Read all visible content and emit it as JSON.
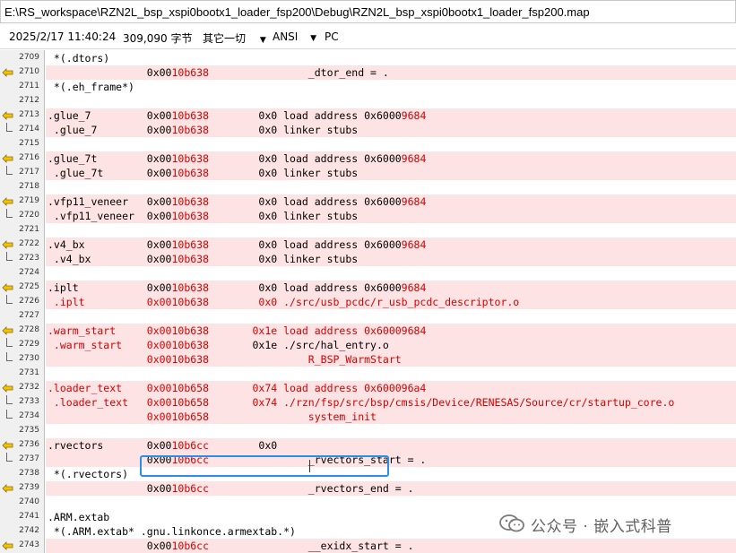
{
  "window": {
    "title": "E:\\RS_workspace\\RZN2L_bsp_xspi0bootx1_loader_fsp200\\Debug\\RZN2L_bsp_xspi0bootx1_loader_fsp200.map"
  },
  "status_bar": {
    "datetime": "2025/2/17 11:40:24",
    "size": "309,090 字节",
    "line_ending": "其它一切",
    "encoding": "ANSI",
    "platform": "PC"
  },
  "colors": {
    "highlight_bg": "#fde3e3",
    "red_text": "#d40000",
    "selection_box": "#2d8ee6"
  },
  "lines": [
    {
      "num": "2709",
      "mark": "",
      "hl": false,
      "segs": [
        {
          "t": " *(.dtors)",
          "c": "k"
        }
      ]
    },
    {
      "num": "2710",
      "mark": "arrow",
      "hl": true,
      "segs": [
        {
          "t": "                0x00",
          "c": "k"
        },
        {
          "t": "10b638",
          "c": "r"
        },
        {
          "t": "                _dtor_end = .",
          "c": "k"
        }
      ]
    },
    {
      "num": "2711",
      "mark": "",
      "hl": false,
      "segs": [
        {
          "t": " *(.eh_frame*)",
          "c": "k"
        }
      ]
    },
    {
      "num": "2712",
      "mark": "",
      "hl": false,
      "segs": []
    },
    {
      "num": "2713",
      "mark": "arrow",
      "hl": true,
      "segs": [
        {
          "t": ".glue_7         0x00",
          "c": "k"
        },
        {
          "t": "10b638",
          "c": "r"
        },
        {
          "t": "        0x0 load address 0x6000",
          "c": "k"
        },
        {
          "t": "9684",
          "c": "r"
        }
      ]
    },
    {
      "num": "2714",
      "mark": "bracket",
      "hl": true,
      "segs": [
        {
          "t": " .glue_7        0x00",
          "c": "k"
        },
        {
          "t": "10b638",
          "c": "r"
        },
        {
          "t": "        0x0 linker stubs",
          "c": "k"
        }
      ]
    },
    {
      "num": "2715",
      "mark": "",
      "hl": false,
      "segs": []
    },
    {
      "num": "2716",
      "mark": "arrow",
      "hl": true,
      "segs": [
        {
          "t": ".glue_7t        0x00",
          "c": "k"
        },
        {
          "t": "10b638",
          "c": "r"
        },
        {
          "t": "        0x0 load address 0x6000",
          "c": "k"
        },
        {
          "t": "9684",
          "c": "r"
        }
      ]
    },
    {
      "num": "2717",
      "mark": "bracket",
      "hl": true,
      "segs": [
        {
          "t": " .glue_7t       0x00",
          "c": "k"
        },
        {
          "t": "10b638",
          "c": "r"
        },
        {
          "t": "        0x0 linker stubs",
          "c": "k"
        }
      ]
    },
    {
      "num": "2718",
      "mark": "",
      "hl": false,
      "segs": []
    },
    {
      "num": "2719",
      "mark": "arrow",
      "hl": true,
      "segs": [
        {
          "t": ".vfp11_veneer   0x00",
          "c": "k"
        },
        {
          "t": "10b638",
          "c": "r"
        },
        {
          "t": "        0x0 load address 0x6000",
          "c": "k"
        },
        {
          "t": "9684",
          "c": "r"
        }
      ]
    },
    {
      "num": "2720",
      "mark": "bracket",
      "hl": true,
      "segs": [
        {
          "t": " .vfp11_veneer  0x00",
          "c": "k"
        },
        {
          "t": "10b638",
          "c": "r"
        },
        {
          "t": "        0x0 linker stubs",
          "c": "k"
        }
      ]
    },
    {
      "num": "2721",
      "mark": "",
      "hl": false,
      "segs": []
    },
    {
      "num": "2722",
      "mark": "arrow",
      "hl": true,
      "segs": [
        {
          "t": ".v4_bx          0x00",
          "c": "k"
        },
        {
          "t": "10b638",
          "c": "r"
        },
        {
          "t": "        0x0 load address 0x6000",
          "c": "k"
        },
        {
          "t": "9684",
          "c": "r"
        }
      ]
    },
    {
      "num": "2723",
      "mark": "bracket",
      "hl": true,
      "segs": [
        {
          "t": " .v4_bx         0x00",
          "c": "k"
        },
        {
          "t": "10b638",
          "c": "r"
        },
        {
          "t": "        0x0 linker stubs",
          "c": "k"
        }
      ]
    },
    {
      "num": "2724",
      "mark": "",
      "hl": false,
      "segs": []
    },
    {
      "num": "2725",
      "mark": "arrow",
      "hl": true,
      "segs": [
        {
          "t": ".iplt           0x00",
          "c": "k"
        },
        {
          "t": "10b638",
          "c": "r"
        },
        {
          "t": "        0x0 load address 0x6000",
          "c": "k"
        },
        {
          "t": "9684",
          "c": "r"
        }
      ]
    },
    {
      "num": "2726",
      "mark": "bracket",
      "hl": true,
      "segs": [
        {
          "t": " .iplt          0x00",
          "c": "r"
        },
        {
          "t": "10b638",
          "c": "r"
        },
        {
          "t": "        0x0 ./src/usb_pcdc/r_usb_pcdc_descriptor.o",
          "c": "r"
        }
      ]
    },
    {
      "num": "2727",
      "mark": "",
      "hl": false,
      "segs": []
    },
    {
      "num": "2728",
      "mark": "arrow",
      "hl": true,
      "segs": [
        {
          "t": ".warm_start     0x00",
          "c": "r"
        },
        {
          "t": "10b638",
          "c": "r"
        },
        {
          "t": "       0x1e load address 0x6000",
          "c": "r"
        },
        {
          "t": "9684",
          "c": "r"
        }
      ]
    },
    {
      "num": "2729",
      "mark": "bracket",
      "hl": true,
      "segs": [
        {
          "t": " .warm_start    0x00",
          "c": "r"
        },
        {
          "t": "10b638",
          "c": "r"
        },
        {
          "t": "       0x1e ./src/hal_entry.o",
          "c": "k"
        }
      ]
    },
    {
      "num": "2730",
      "mark": "tick",
      "hl": true,
      "segs": [
        {
          "t": "                0x00",
          "c": "r"
        },
        {
          "t": "10b638",
          "c": "r"
        },
        {
          "t": "                R_BSP_WarmStart",
          "c": "r"
        }
      ]
    },
    {
      "num": "2731",
      "mark": "",
      "hl": false,
      "segs": []
    },
    {
      "num": "2732",
      "mark": "arrow",
      "hl": true,
      "segs": [
        {
          "t": ".loader_text    0x00",
          "c": "r"
        },
        {
          "t": "10b658",
          "c": "r"
        },
        {
          "t": "       0x74 load address 0x600096a4",
          "c": "r"
        }
      ]
    },
    {
      "num": "2733",
      "mark": "bracket",
      "hl": true,
      "segs": [
        {
          "t": " .loader_text   0x00",
          "c": "r"
        },
        {
          "t": "10b658",
          "c": "r"
        },
        {
          "t": "       0x74 ./rzn/fsp/src/bsp/cmsis/Device/RENESAS/Source/cr/startup_core.o",
          "c": "r"
        }
      ]
    },
    {
      "num": "2734",
      "mark": "tick",
      "hl": true,
      "segs": [
        {
          "t": "                0x00",
          "c": "r"
        },
        {
          "t": "10b658",
          "c": "r"
        },
        {
          "t": "                system_init",
          "c": "r"
        }
      ]
    },
    {
      "num": "2735",
      "mark": "",
      "hl": false,
      "segs": []
    },
    {
      "num": "2736",
      "mark": "arrow",
      "hl": true,
      "segs": [
        {
          "t": ".rvectors       0x00",
          "c": "k"
        },
        {
          "t": "10b6cc",
          "c": "r"
        },
        {
          "t": "        0x0",
          "c": "k"
        }
      ]
    },
    {
      "num": "2737",
      "mark": "bracket",
      "hl": true,
      "segs": [
        {
          "t": "                0x00",
          "c": "k"
        },
        {
          "t": "10b6cc",
          "c": "r"
        },
        {
          "t": "                _rvectors_start = .",
          "c": "k"
        }
      ]
    },
    {
      "num": "2738",
      "mark": "",
      "hl": false,
      "segs": [
        {
          "t": " *(.rvectors)",
          "c": "k"
        }
      ]
    },
    {
      "num": "2739",
      "mark": "arrow",
      "hl": true,
      "segs": [
        {
          "t": "                0x00",
          "c": "k"
        },
        {
          "t": "10b6cc",
          "c": "r"
        },
        {
          "t": "                _rvectors_end = .",
          "c": "k"
        }
      ]
    },
    {
      "num": "2740",
      "mark": "",
      "hl": false,
      "segs": []
    },
    {
      "num": "2741",
      "mark": "",
      "hl": false,
      "segs": [
        {
          "t": ".ARM.extab",
          "c": "k"
        }
      ]
    },
    {
      "num": "2742",
      "mark": "",
      "hl": false,
      "segs": [
        {
          "t": " *(.ARM.extab* .gnu.linkonce.armextab.*)",
          "c": "k"
        }
      ]
    },
    {
      "num": "2743",
      "mark": "arrow",
      "hl": true,
      "segs": [
        {
          "t": "                0x00",
          "c": "k"
        },
        {
          "t": "10b6cc",
          "c": "r"
        },
        {
          "t": "                __exidx_start = .",
          "c": "k"
        }
      ]
    }
  ],
  "watermark": {
    "icon": "wechat-icon",
    "text": "公众号 · 嵌入式科普"
  }
}
